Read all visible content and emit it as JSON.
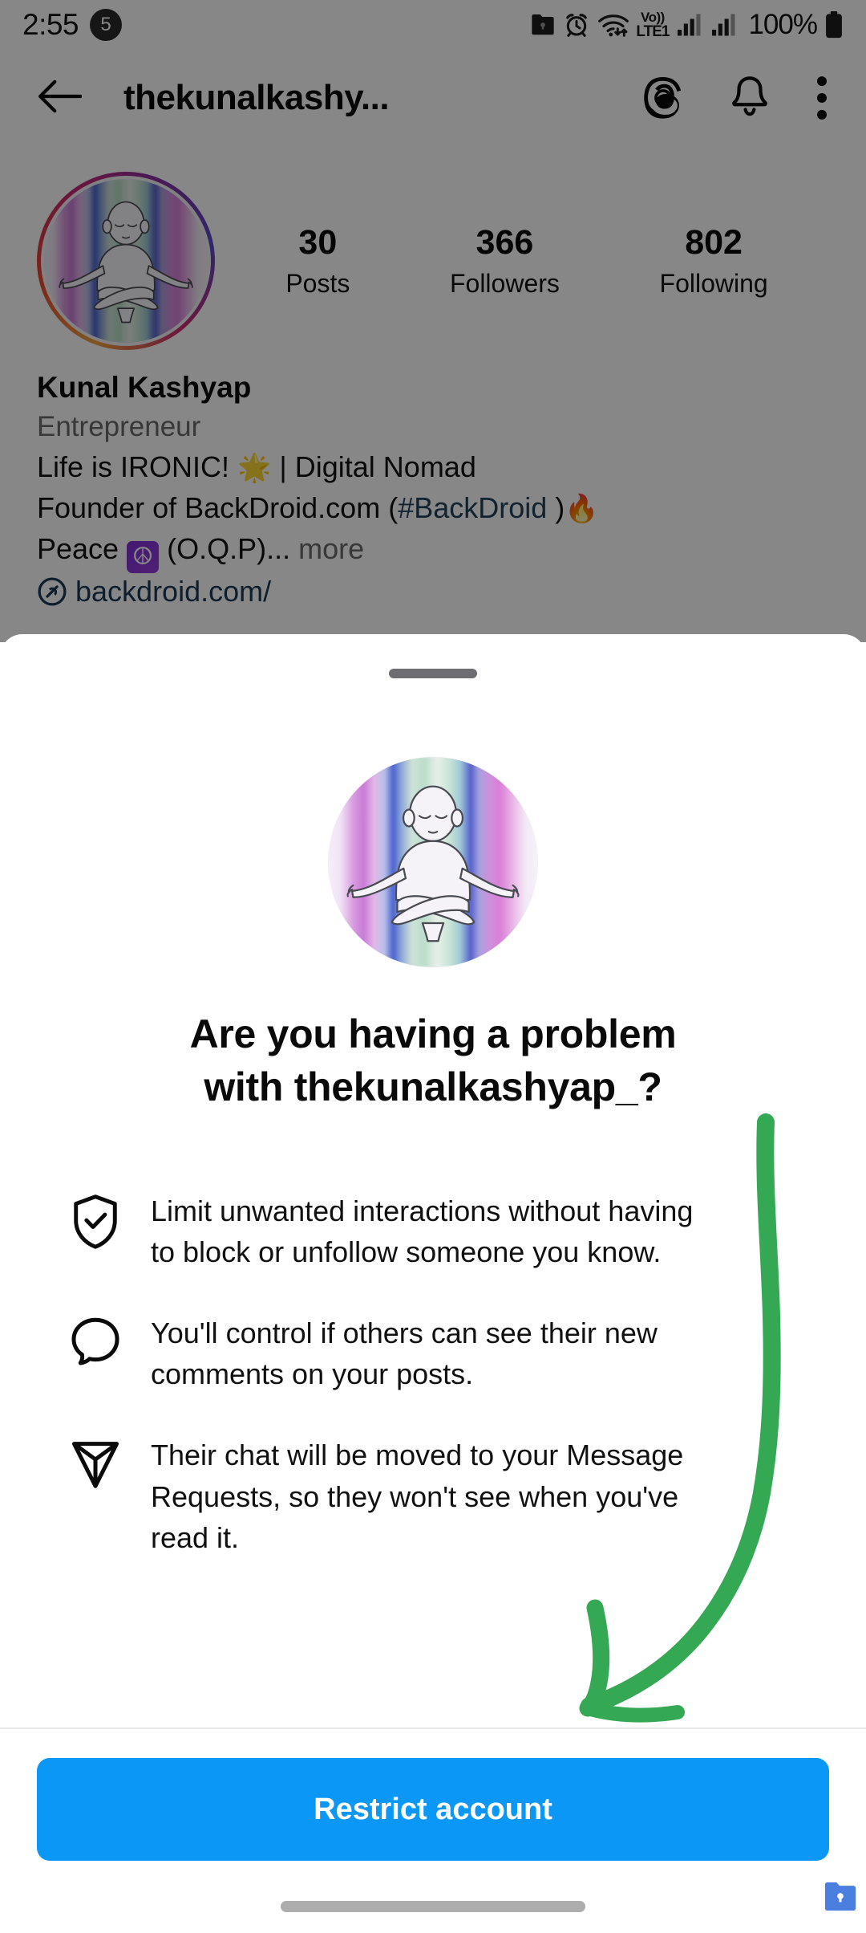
{
  "status_bar": {
    "time": "2:55",
    "notification_count": "5",
    "icons": [
      "secure-folder-icon",
      "alarm-icon",
      "wifi-icon"
    ],
    "network_label_top": "Vo))",
    "network_label_bottom": "LTE1",
    "battery_percent": "100%"
  },
  "header": {
    "back_icon": "back-arrow-icon",
    "title": "thekunalkashy...",
    "threads_icon": "threads-icon",
    "bell_icon": "notification-bell-icon",
    "menu_icon": "overflow-menu-icon"
  },
  "profile": {
    "avatar_alt": "meditating-figure-avatar",
    "stats": [
      {
        "value": "30",
        "label": "Posts"
      },
      {
        "value": "366",
        "label": "Followers"
      },
      {
        "value": "802",
        "label": "Following"
      }
    ],
    "display_name": "Kunal Kashyap",
    "category": "Entrepreneur",
    "bio_line_1_pre": "Life is IRONIC! ",
    "bio_line_1_emoji": "🌟",
    "bio_line_1_post": " | Digital Nomad",
    "bio_line_2_pre": "Founder of BackDroid.com (",
    "bio_line_2_tag": "#BackDroid",
    "bio_line_2_post": " )",
    "bio_line_2_emoji": "🔥",
    "bio_line_3_pre": "Peace ",
    "bio_line_3_peace": "☮",
    "bio_line_3_post": " (O.Q.P)...",
    "bio_more": " more",
    "link_icon": "link-icon",
    "link_text": "backdroid.com/"
  },
  "sheet": {
    "handle": "drag-handle",
    "avatar_alt": "meditating-figure-avatar",
    "title": "Are you having a problem with thekunalkashyap_?",
    "title_line_1": "Are you having a problem",
    "title_line_2": "with thekunalkashyap_?",
    "features": [
      {
        "icon": "shield-check-icon",
        "line_1": "Limit unwanted interactions without having",
        "line_2": "to block or unfollow someone you know."
      },
      {
        "icon": "comment-bubble-icon",
        "line_1": "You'll control if others can see their new",
        "line_2": "comments on your posts."
      },
      {
        "icon": "direct-message-icon",
        "line_1": "Their chat will be moved to your Message",
        "line_2": "Requests, so they won't see when you've",
        "line_3": "read it."
      }
    ],
    "cta_label": "Restrict account"
  },
  "annotation": {
    "type": "hand-drawn-arrow",
    "color": "#35a853",
    "points_to": "restrict-account-button"
  },
  "system": {
    "nav_handle": "gesture-nav-handle",
    "corner_icon": "secure-folder-icon",
    "corner_icon_color": "#4a7fe0"
  },
  "colors": {
    "cta_blue": "#0a97f5",
    "annotation_green": "#35a853",
    "scrim": "rgba(0,0,0,0.47)"
  }
}
